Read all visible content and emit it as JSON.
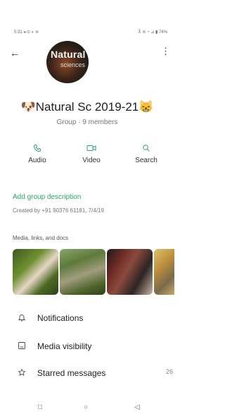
{
  "status_bar": {
    "left_text": "5:31 ◂ ⊙ ◐ ≋",
    "right_text": "⊼ ≋ ◔ ⊿ ▮ 74%"
  },
  "header": {
    "back_glyph": "←",
    "menu_glyph": "⋮"
  },
  "avatar": {
    "line1": "Natural",
    "line2": "sciences"
  },
  "group": {
    "name": "🐶Natural Sc 2019-21😸",
    "subtitle": "Group · 9 members"
  },
  "actions": [
    {
      "label": "Audio",
      "icon": "phone-icon"
    },
    {
      "label": "Video",
      "icon": "video-icon"
    },
    {
      "label": "Search",
      "icon": "search-icon"
    }
  ],
  "description": {
    "add_label": "Add group description",
    "created_text": "Created by +91 90376 61181, 7/4/19"
  },
  "media": {
    "title": "Media, links, and docs",
    "colors": {
      "thumb1": "#5a7b2e",
      "thumb2": "#6f7f45",
      "thumb3": "#5a2a22",
      "thumb4": "#c89a40"
    }
  },
  "settings": [
    {
      "label": "Notifications",
      "icon": "bell-icon",
      "value": ""
    },
    {
      "label": "Media visibility",
      "icon": "image-icon",
      "value": ""
    },
    {
      "label": "Starred messages",
      "icon": "star-icon",
      "value": "26"
    }
  ],
  "nav": {
    "recent_glyph": "□",
    "home_glyph": "○",
    "back_glyph": "◁"
  },
  "colors": {
    "accent_green": "#2aa46a"
  }
}
